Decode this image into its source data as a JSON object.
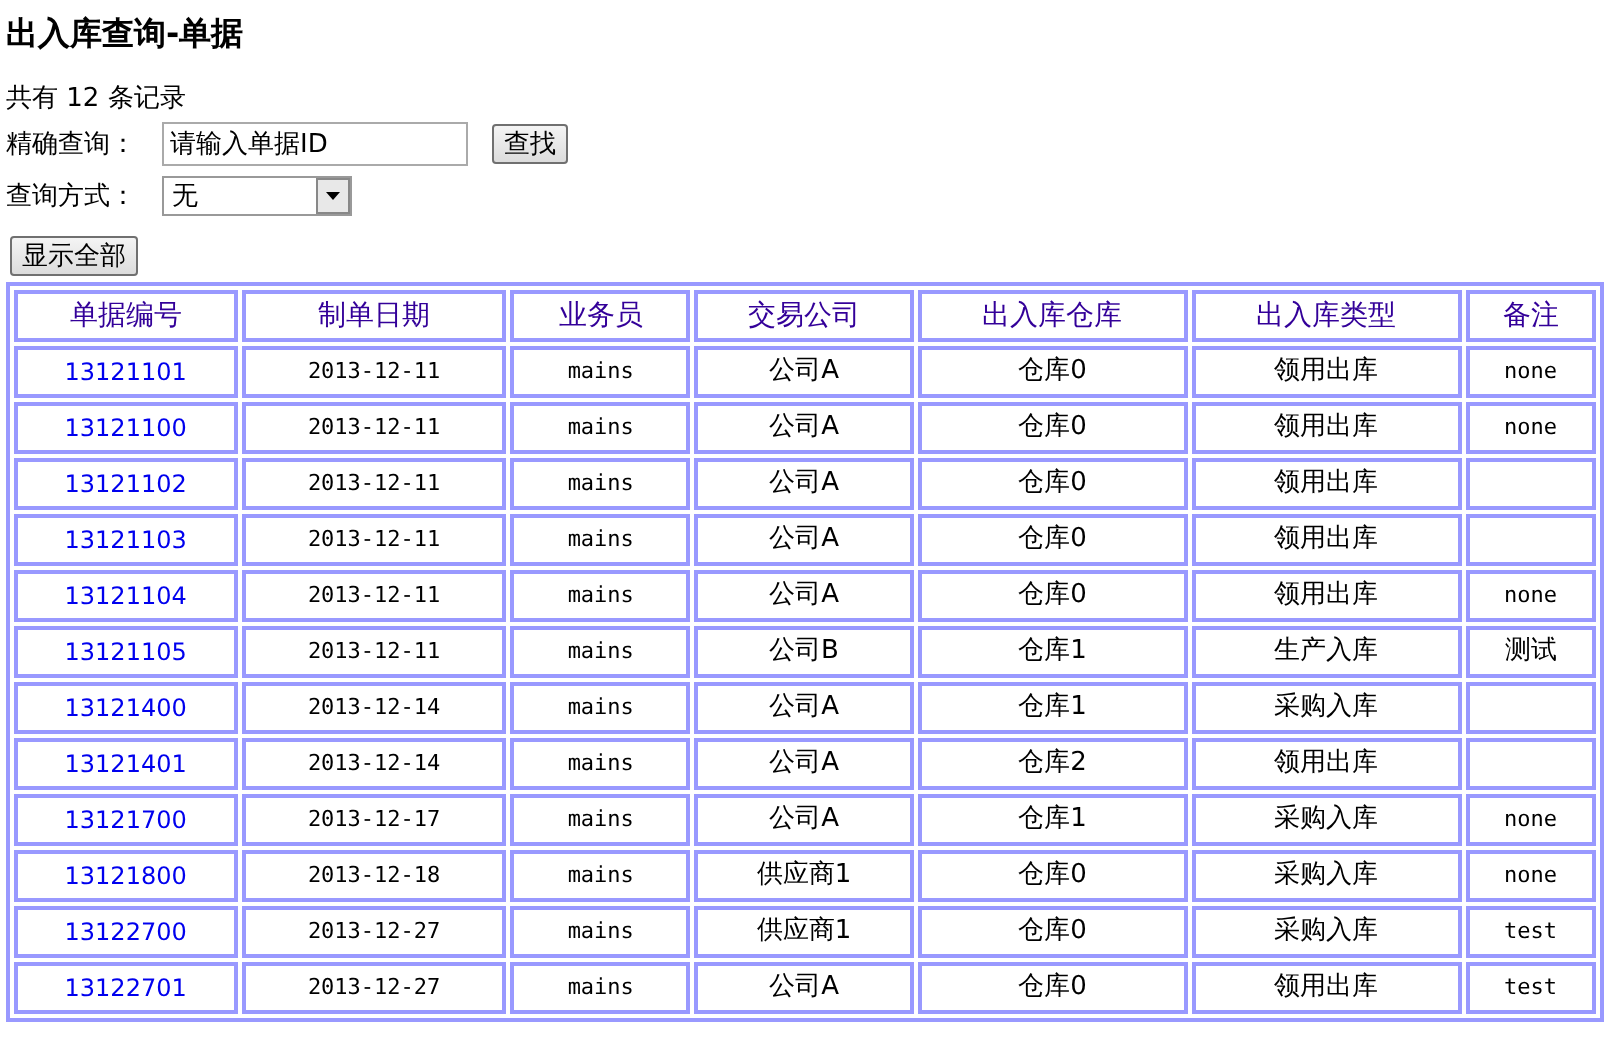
{
  "title": "出入库查询-单据",
  "record_count": "共有 12 条记录",
  "search": {
    "label": "精确查询：",
    "value": "请输入单据ID",
    "button": "查找"
  },
  "mode": {
    "label": "查询方式：",
    "value": "无"
  },
  "show_all_button": "显示全部",
  "table": {
    "columns": [
      "单据编号",
      "制单日期",
      "业务员",
      "交易公司",
      "出入库仓库",
      "出入库类型",
      "备注"
    ],
    "rows": [
      {
        "id": "13121101",
        "date": "2013-12-11",
        "clerk": "mains",
        "company": "公司A",
        "warehouse": "仓库0",
        "type": "领用出库",
        "remark": "none"
      },
      {
        "id": "13121100",
        "date": "2013-12-11",
        "clerk": "mains",
        "company": "公司A",
        "warehouse": "仓库0",
        "type": "领用出库",
        "remark": "none"
      },
      {
        "id": "13121102",
        "date": "2013-12-11",
        "clerk": "mains",
        "company": "公司A",
        "warehouse": "仓库0",
        "type": "领用出库"
      },
      {
        "id": "13121103",
        "date": "2013-12-11",
        "clerk": "mains",
        "company": "公司A",
        "warehouse": "仓库0",
        "type": "领用出库"
      },
      {
        "id": "13121104",
        "date": "2013-12-11",
        "clerk": "mains",
        "company": "公司A",
        "warehouse": "仓库0",
        "type": "领用出库",
        "remark": "none"
      },
      {
        "id": "13121105",
        "date": "2013-12-11",
        "clerk": "mains",
        "company": "公司B",
        "warehouse": "仓库1",
        "type": "生产入库",
        "remark": "测试"
      },
      {
        "id": "13121400",
        "date": "2013-12-14",
        "clerk": "mains",
        "company": "公司A",
        "warehouse": "仓库1",
        "type": "采购入库"
      },
      {
        "id": "13121401",
        "date": "2013-12-14",
        "clerk": "mains",
        "company": "公司A",
        "warehouse": "仓库2",
        "type": "领用出库"
      },
      {
        "id": "13121700",
        "date": "2013-12-17",
        "clerk": "mains",
        "company": "公司A",
        "warehouse": "仓库1",
        "type": "采购入库",
        "remark": "none"
      },
      {
        "id": "13121800",
        "date": "2013-12-18",
        "clerk": "mains",
        "company": "供应商1",
        "warehouse": "仓库0",
        "type": "采购入库",
        "remark": "none"
      },
      {
        "id": "13122700",
        "date": "2013-12-27",
        "clerk": "mains",
        "company": "供应商1",
        "warehouse": "仓库0",
        "type": "采购入库",
        "remark": "test"
      },
      {
        "id": "13122701",
        "date": "2013-12-27",
        "clerk": "mains",
        "company": "公司A",
        "warehouse": "仓库0",
        "type": "领用出库",
        "remark": "test"
      }
    ]
  }
}
